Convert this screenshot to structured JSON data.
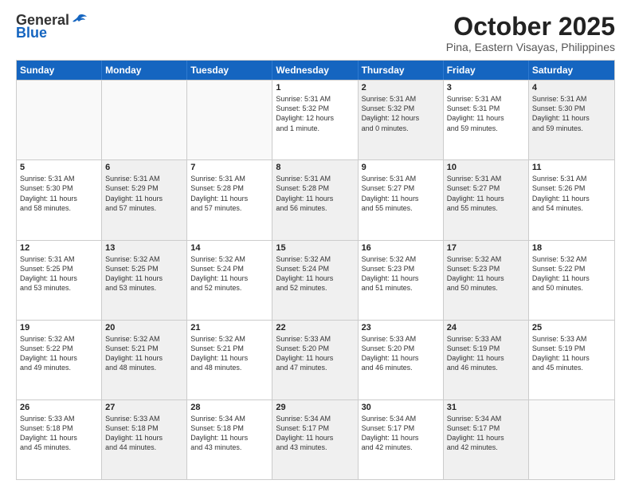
{
  "header": {
    "logo_general": "General",
    "logo_blue": "Blue",
    "month_title": "October 2025",
    "location": "Pina, Eastern Visayas, Philippines"
  },
  "calendar": {
    "days_of_week": [
      "Sunday",
      "Monday",
      "Tuesday",
      "Wednesday",
      "Thursday",
      "Friday",
      "Saturday"
    ],
    "rows": [
      [
        {
          "day": "",
          "empty": true,
          "shaded": false,
          "lines": []
        },
        {
          "day": "",
          "empty": true,
          "shaded": false,
          "lines": []
        },
        {
          "day": "",
          "empty": true,
          "shaded": false,
          "lines": []
        },
        {
          "day": "1",
          "empty": false,
          "shaded": false,
          "lines": [
            "Sunrise: 5:31 AM",
            "Sunset: 5:32 PM",
            "Daylight: 12 hours",
            "and 1 minute."
          ]
        },
        {
          "day": "2",
          "empty": false,
          "shaded": true,
          "lines": [
            "Sunrise: 5:31 AM",
            "Sunset: 5:32 PM",
            "Daylight: 12 hours",
            "and 0 minutes."
          ]
        },
        {
          "day": "3",
          "empty": false,
          "shaded": false,
          "lines": [
            "Sunrise: 5:31 AM",
            "Sunset: 5:31 PM",
            "Daylight: 11 hours",
            "and 59 minutes."
          ]
        },
        {
          "day": "4",
          "empty": false,
          "shaded": true,
          "lines": [
            "Sunrise: 5:31 AM",
            "Sunset: 5:30 PM",
            "Daylight: 11 hours",
            "and 59 minutes."
          ]
        }
      ],
      [
        {
          "day": "5",
          "empty": false,
          "shaded": false,
          "lines": [
            "Sunrise: 5:31 AM",
            "Sunset: 5:30 PM",
            "Daylight: 11 hours",
            "and 58 minutes."
          ]
        },
        {
          "day": "6",
          "empty": false,
          "shaded": true,
          "lines": [
            "Sunrise: 5:31 AM",
            "Sunset: 5:29 PM",
            "Daylight: 11 hours",
            "and 57 minutes."
          ]
        },
        {
          "day": "7",
          "empty": false,
          "shaded": false,
          "lines": [
            "Sunrise: 5:31 AM",
            "Sunset: 5:28 PM",
            "Daylight: 11 hours",
            "and 57 minutes."
          ]
        },
        {
          "day": "8",
          "empty": false,
          "shaded": true,
          "lines": [
            "Sunrise: 5:31 AM",
            "Sunset: 5:28 PM",
            "Daylight: 11 hours",
            "and 56 minutes."
          ]
        },
        {
          "day": "9",
          "empty": false,
          "shaded": false,
          "lines": [
            "Sunrise: 5:31 AM",
            "Sunset: 5:27 PM",
            "Daylight: 11 hours",
            "and 55 minutes."
          ]
        },
        {
          "day": "10",
          "empty": false,
          "shaded": true,
          "lines": [
            "Sunrise: 5:31 AM",
            "Sunset: 5:27 PM",
            "Daylight: 11 hours",
            "and 55 minutes."
          ]
        },
        {
          "day": "11",
          "empty": false,
          "shaded": false,
          "lines": [
            "Sunrise: 5:31 AM",
            "Sunset: 5:26 PM",
            "Daylight: 11 hours",
            "and 54 minutes."
          ]
        }
      ],
      [
        {
          "day": "12",
          "empty": false,
          "shaded": false,
          "lines": [
            "Sunrise: 5:31 AM",
            "Sunset: 5:25 PM",
            "Daylight: 11 hours",
            "and 53 minutes."
          ]
        },
        {
          "day": "13",
          "empty": false,
          "shaded": true,
          "lines": [
            "Sunrise: 5:32 AM",
            "Sunset: 5:25 PM",
            "Daylight: 11 hours",
            "and 53 minutes."
          ]
        },
        {
          "day": "14",
          "empty": false,
          "shaded": false,
          "lines": [
            "Sunrise: 5:32 AM",
            "Sunset: 5:24 PM",
            "Daylight: 11 hours",
            "and 52 minutes."
          ]
        },
        {
          "day": "15",
          "empty": false,
          "shaded": true,
          "lines": [
            "Sunrise: 5:32 AM",
            "Sunset: 5:24 PM",
            "Daylight: 11 hours",
            "and 52 minutes."
          ]
        },
        {
          "day": "16",
          "empty": false,
          "shaded": false,
          "lines": [
            "Sunrise: 5:32 AM",
            "Sunset: 5:23 PM",
            "Daylight: 11 hours",
            "and 51 minutes."
          ]
        },
        {
          "day": "17",
          "empty": false,
          "shaded": true,
          "lines": [
            "Sunrise: 5:32 AM",
            "Sunset: 5:23 PM",
            "Daylight: 11 hours",
            "and 50 minutes."
          ]
        },
        {
          "day": "18",
          "empty": false,
          "shaded": false,
          "lines": [
            "Sunrise: 5:32 AM",
            "Sunset: 5:22 PM",
            "Daylight: 11 hours",
            "and 50 minutes."
          ]
        }
      ],
      [
        {
          "day": "19",
          "empty": false,
          "shaded": false,
          "lines": [
            "Sunrise: 5:32 AM",
            "Sunset: 5:22 PM",
            "Daylight: 11 hours",
            "and 49 minutes."
          ]
        },
        {
          "day": "20",
          "empty": false,
          "shaded": true,
          "lines": [
            "Sunrise: 5:32 AM",
            "Sunset: 5:21 PM",
            "Daylight: 11 hours",
            "and 48 minutes."
          ]
        },
        {
          "day": "21",
          "empty": false,
          "shaded": false,
          "lines": [
            "Sunrise: 5:32 AM",
            "Sunset: 5:21 PM",
            "Daylight: 11 hours",
            "and 48 minutes."
          ]
        },
        {
          "day": "22",
          "empty": false,
          "shaded": true,
          "lines": [
            "Sunrise: 5:33 AM",
            "Sunset: 5:20 PM",
            "Daylight: 11 hours",
            "and 47 minutes."
          ]
        },
        {
          "day": "23",
          "empty": false,
          "shaded": false,
          "lines": [
            "Sunrise: 5:33 AM",
            "Sunset: 5:20 PM",
            "Daylight: 11 hours",
            "and 46 minutes."
          ]
        },
        {
          "day": "24",
          "empty": false,
          "shaded": true,
          "lines": [
            "Sunrise: 5:33 AM",
            "Sunset: 5:19 PM",
            "Daylight: 11 hours",
            "and 46 minutes."
          ]
        },
        {
          "day": "25",
          "empty": false,
          "shaded": false,
          "lines": [
            "Sunrise: 5:33 AM",
            "Sunset: 5:19 PM",
            "Daylight: 11 hours",
            "and 45 minutes."
          ]
        }
      ],
      [
        {
          "day": "26",
          "empty": false,
          "shaded": false,
          "lines": [
            "Sunrise: 5:33 AM",
            "Sunset: 5:18 PM",
            "Daylight: 11 hours",
            "and 45 minutes."
          ]
        },
        {
          "day": "27",
          "empty": false,
          "shaded": true,
          "lines": [
            "Sunrise: 5:33 AM",
            "Sunset: 5:18 PM",
            "Daylight: 11 hours",
            "and 44 minutes."
          ]
        },
        {
          "day": "28",
          "empty": false,
          "shaded": false,
          "lines": [
            "Sunrise: 5:34 AM",
            "Sunset: 5:18 PM",
            "Daylight: 11 hours",
            "and 43 minutes."
          ]
        },
        {
          "day": "29",
          "empty": false,
          "shaded": true,
          "lines": [
            "Sunrise: 5:34 AM",
            "Sunset: 5:17 PM",
            "Daylight: 11 hours",
            "and 43 minutes."
          ]
        },
        {
          "day": "30",
          "empty": false,
          "shaded": false,
          "lines": [
            "Sunrise: 5:34 AM",
            "Sunset: 5:17 PM",
            "Daylight: 11 hours",
            "and 42 minutes."
          ]
        },
        {
          "day": "31",
          "empty": false,
          "shaded": true,
          "lines": [
            "Sunrise: 5:34 AM",
            "Sunset: 5:17 PM",
            "Daylight: 11 hours",
            "and 42 minutes."
          ]
        },
        {
          "day": "",
          "empty": true,
          "shaded": false,
          "lines": []
        }
      ]
    ]
  }
}
